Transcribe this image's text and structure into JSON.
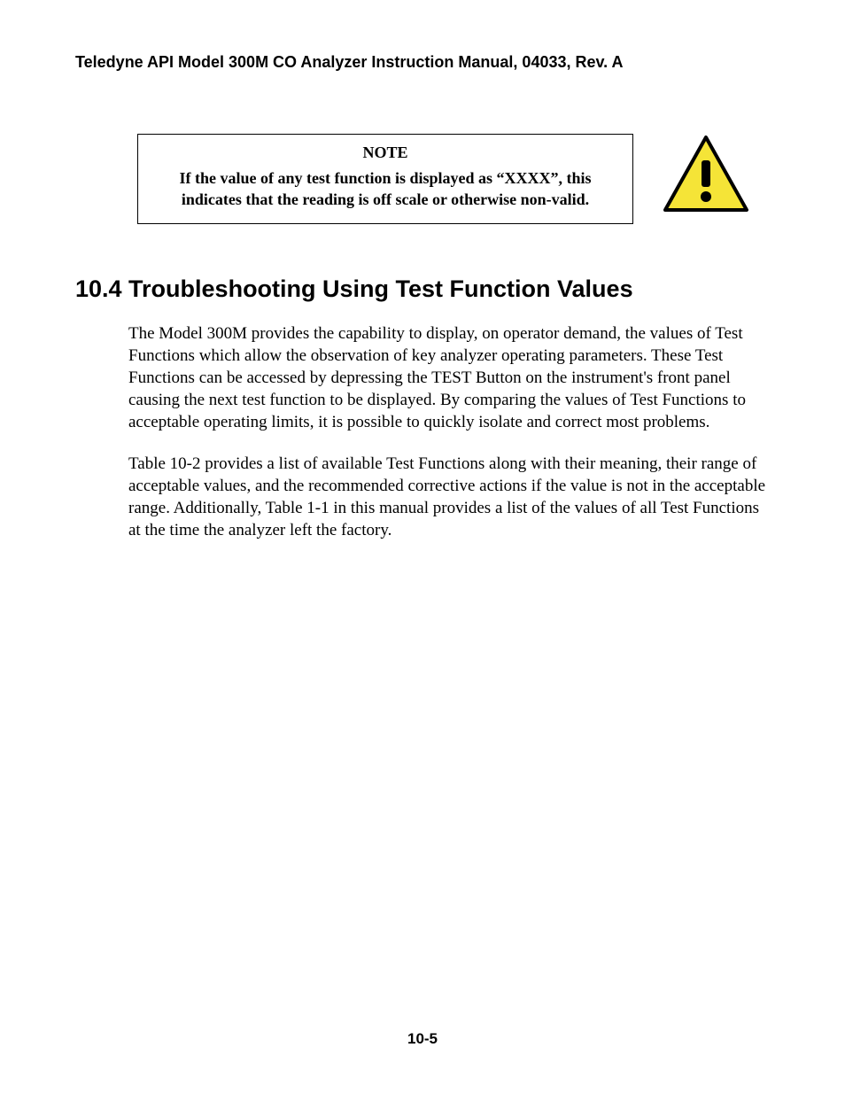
{
  "header": {
    "title": "Teledyne API Model 300M CO Analyzer Instruction Manual, 04033, Rev. A"
  },
  "note": {
    "label": "NOTE",
    "body": "If the value of any test function is displayed as “XXXX”, this indicates that the reading is off scale or otherwise non-valid."
  },
  "icon": {
    "name": "warning-icon",
    "fill": "#f5e437",
    "stroke": "#000000"
  },
  "section": {
    "heading": "10.4  Troubleshooting Using Test Function Values",
    "paragraphs": [
      "The Model 300M provides the capability to display, on operator demand, the values of Test Functions which allow the observation of key analyzer operating parameters. These Test Functions can be accessed by depressing the TEST Button on the instrument's front panel causing the next test function to be displayed. By comparing the values of Test Functions to acceptable operating limits, it is possible to quickly isolate and correct most problems.",
      "Table 10-2 provides a list of available Test Functions along with their meaning, their range of acceptable values, and the recommended corrective actions if the value is not in the acceptable range. Additionally, Table 1-1 in this manual provides a list of the values of all Test Functions at the time the analyzer left the factory."
    ]
  },
  "footer": {
    "page_number": "10-5"
  }
}
